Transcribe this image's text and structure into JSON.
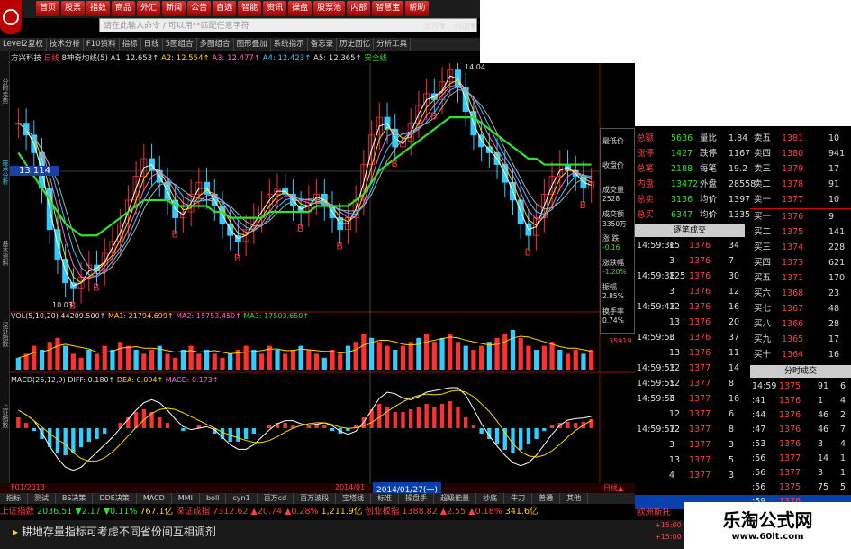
{
  "menu": {
    "items": [
      "首页",
      "股票",
      "指数",
      "商品",
      "外汇",
      "新闻",
      "公告",
      "自选",
      "智能",
      "资讯",
      "操盘",
      "股票池",
      "内部",
      "智慧宝",
      "帮助"
    ]
  },
  "search": {
    "placeholder": "请在此输入命令 / 可以用**匹配任意字符",
    "file_label": "文件▼",
    "layout_label": "画面▼"
  },
  "toolbar": {
    "items": [
      "Level2复权",
      "技术分析",
      "F10资料",
      "指标",
      "日线",
      "5图组合",
      "多图组合",
      "图形叠加",
      "系统指示",
      "备忘录",
      "历史回忆",
      "分析工具"
    ]
  },
  "chart_header": {
    "stock": "方兴科技",
    "period": "日线",
    "indicator": "8神奇均线(5)",
    "ma": [
      "A1: 12.653↑",
      "A2: 12.554↑",
      "A3: 12.477↑",
      "A4: 12.423↑",
      "A5: 12.365↑"
    ],
    "flag": "安全线"
  },
  "price_labels": {
    "cursor_price": "13.114",
    "low": "10.03",
    "high": "14.04"
  },
  "vol_header": {
    "name": "VOL(5,10,20)",
    "value": "44209.500↑",
    "ma1": "MA1: 21794.699↑",
    "ma2": "MA2: 15753.450↑",
    "ma3": "MA3: 17503.650↑",
    "right": "35919"
  },
  "macd_header": {
    "name": "MACD(26,12,9)",
    "diff": "DIFF: 0.180↑",
    "dea": "DEA: 0.094↑",
    "macd": "MACD: 0.173↑"
  },
  "date_labels": {
    "left": "F01/2013",
    "mid": "2014/01",
    "cursor_date": "2014/01/27(一)",
    "period": "日线▲"
  },
  "stats_panel": [
    {
      "label": "最低价",
      "value": ""
    },
    {
      "label": "收盘价",
      "value": ""
    },
    {
      "label": "成交量",
      "value": "2528"
    },
    {
      "label": "成交额",
      "value": "3350万"
    },
    {
      "label": "涨 跌",
      "value": "-0.16"
    },
    {
      "label": "涨跌幅",
      "value": "-1.20%"
    },
    {
      "label": "振幅",
      "value": "2.85%"
    },
    {
      "label": "换手率",
      "value": "0.74%"
    }
  ],
  "quote_top": [
    {
      "k1": "总额",
      "v1": "5636",
      "k2": "量比",
      "v2": "1.84"
    },
    {
      "k1": "涨停",
      "v1": "1427",
      "k2": "跌停",
      "v2": "1167"
    },
    {
      "k1": "总笔",
      "v1": "2188",
      "k2": "每笔",
      "v2": "19.2"
    },
    {
      "k1": "内盘",
      "v1": "13472",
      "k2": "外盘",
      "v2": "28558"
    },
    {
      "k1": "总卖",
      "v1": "3136",
      "k2": "均价",
      "v2": "1397"
    },
    {
      "k1": "总买",
      "v1": "6347",
      "k2": "均价",
      "v2": "1335"
    }
  ],
  "sell_orders": [
    {
      "name": "卖五",
      "price": "1381",
      "vol": "10"
    },
    {
      "name": "卖四",
      "price": "1380",
      "vol": "941"
    },
    {
      "name": "卖三",
      "price": "1379",
      "vol": "17"
    },
    {
      "name": "卖二",
      "price": "1378",
      "vol": "91"
    },
    {
      "name": "卖一",
      "price": "1377",
      "vol": "10"
    }
  ],
  "buy_orders": [
    {
      "name": "买一",
      "price": "1376",
      "vol": "9"
    },
    {
      "name": "买二",
      "price": "1375",
      "vol": "141"
    },
    {
      "name": "买三",
      "price": "1374",
      "vol": "228"
    },
    {
      "name": "买四",
      "price": "1373",
      "vol": "621"
    },
    {
      "name": "买五",
      "price": "1371",
      "vol": "170"
    },
    {
      "name": "买六",
      "price": "1368",
      "vol": "23"
    },
    {
      "name": "买七",
      "price": "1367",
      "vol": "48"
    },
    {
      "name": "买八",
      "price": "1366",
      "vol": "28"
    },
    {
      "name": "买九",
      "price": "1365",
      "vol": "17"
    },
    {
      "name": "买十",
      "price": "1364",
      "vol": "16"
    }
  ],
  "tick_header": "逐笔成交",
  "ticks": [
    {
      "t": "14:59:36",
      "a": "15",
      "p": "1376",
      "v": "34"
    },
    {
      "t": "",
      "a": "3",
      "p": "1376",
      "v": "7"
    },
    {
      "t": "14:59:38",
      "a": "125",
      "p": "1376",
      "v": "30"
    },
    {
      "t": "",
      "a": "3",
      "p": "1376",
      "v": "12"
    },
    {
      "t": "14:59:43",
      "a": "12",
      "p": "1376",
      "v": "16"
    },
    {
      "t": "",
      "a": "13",
      "p": "1376",
      "v": "20"
    },
    {
      "t": "14:59:50",
      "a": "3",
      "p": "1376",
      "v": "37"
    },
    {
      "t": "",
      "a": "13",
      "p": "1376",
      "v": "11"
    },
    {
      "t": "14:59:53",
      "a": "12",
      "p": "1377",
      "v": "14"
    },
    {
      "t": "14:59:55",
      "a": "12",
      "p": "1377",
      "v": "8"
    },
    {
      "t": "14:59:56",
      "a": "3",
      "p": "1377",
      "v": "16"
    },
    {
      "t": "",
      "a": "12",
      "p": "1377",
      "v": "6"
    },
    {
      "t": "14:59:57",
      "a": "12",
      "p": "1377",
      "v": "8"
    },
    {
      "t": "",
      "a": "3",
      "p": "1377",
      "v": "3"
    },
    {
      "t": "",
      "a": "13",
      "p": "1377",
      "v": "5"
    },
    {
      "t": "",
      "a": "4",
      "p": "1377",
      "v": "3"
    }
  ],
  "minute_header": "分时成交",
  "minute_ticks": [
    {
      "t": "14:59",
      "p": "1375",
      "v": "91",
      "a": "6"
    },
    {
      "t": ":41",
      "p": "1376",
      "v": "1",
      "a": "4"
    },
    {
      "t": ":44",
      "p": "1376",
      "v": "46",
      "a": "2"
    },
    {
      "t": ":47",
      "p": "1376",
      "v": "46",
      "a": "7"
    },
    {
      "t": ":53",
      "p": "1376",
      "v": "3",
      "a": "4"
    },
    {
      "t": ":56",
      "p": "1377",
      "v": "14",
      "a": "1"
    },
    {
      "t": ":56",
      "p": "1377",
      "v": "3",
      "a": "1"
    },
    {
      "t": ":56",
      "p": "1375",
      "v": "75",
      "a": "5"
    },
    {
      "t": ":59",
      "p": "1376",
      "v": "",
      "a": ""
    }
  ],
  "bottom_tabs": [
    "指标",
    "测试",
    "BS决策",
    "DDE决策",
    "MACD",
    "MMI",
    "boll",
    "cyn1",
    "百万cd",
    "百万波段",
    "宝塔线",
    "标准",
    "操盘手",
    "超级能量",
    "抄底",
    "牛刀",
    "普通",
    "其他"
  ],
  "index_bar": {
    "sh_name": "上证指数",
    "sh_val": "2036.51",
    "sh_chg": "▼2.17",
    "sh_pct": "▼0.11%",
    "sh_amt": "767.1亿",
    "sz_name": "深证成指",
    "sz_val": "7312.62",
    "sz_chg": "▲20.74",
    "sz_pct": "▲0.28%",
    "sz_amt": "1,211.9亿",
    "cy_name": "创业板指",
    "cy_val": "1388.82",
    "cy_chg": "▲2.55",
    "cy_pct": "▲0.18%",
    "cy_amt": "341.6亿",
    "extra": "欧洲斯托"
  },
  "scroll_text": "耕地存量指标可考虑不同省份间互相调剂",
  "clock": {
    "t1": "+15:00",
    "t2": "+15:00"
  },
  "brand": {
    "title": "乐淘公式网",
    "url": "www.60lt.com"
  },
  "left_vertical": [
    "分时走势",
    "技术分析",
    "基本资料",
    "深证指数",
    "上证指数"
  ],
  "marker": "B",
  "chart_data": [
    {
      "type": "candlestick",
      "title": "",
      "ylim": [
        10.03,
        14.04
      ],
      "closes": [
        13.1,
        12.9,
        12.6,
        12.0,
        11.3,
        10.8,
        10.4,
        10.3,
        10.5,
        10.7,
        10.6,
        10.9,
        11.1,
        11.4,
        11.8,
        12.2,
        12.5,
        12.3,
        12.1,
        11.8,
        11.5,
        11.6,
        11.9,
        12.1,
        11.9,
        11.7,
        11.4,
        11.2,
        11.1,
        11.3,
        11.5,
        11.7,
        11.9,
        12.0,
        11.9,
        11.7,
        11.6,
        11.8,
        11.9,
        11.7,
        11.5,
        11.3,
        11.5,
        11.8,
        12.4,
        12.9,
        13.2,
        13.0,
        12.7,
        12.8,
        13.1,
        13.4,
        13.6,
        13.5,
        13.8,
        14.0,
        13.7,
        13.3,
        12.9,
        12.7,
        12.6,
        12.4,
        12.1,
        11.8,
        11.4,
        11.2,
        11.5,
        11.9,
        12.2,
        12.4,
        12.3,
        12.2,
        12.0,
        12.1
      ],
      "series": [
        {
          "name": "A1",
          "values": []
        },
        {
          "name": "安全线",
          "values": [
            12.6,
            12.4,
            12.2,
            12.0,
            11.8,
            11.6,
            11.4,
            11.3,
            11.2,
            11.2,
            11.2,
            11.3,
            11.4,
            11.5,
            11.6,
            11.7,
            11.8,
            11.8,
            11.8,
            11.8,
            11.7,
            11.7,
            11.7,
            11.7,
            11.7,
            11.6,
            11.6,
            11.5,
            11.5,
            11.5,
            11.5,
            11.5,
            11.6,
            11.6,
            11.6,
            11.6,
            11.6,
            11.6,
            11.7,
            11.7,
            11.7,
            11.7,
            11.7,
            11.8,
            11.9,
            12.1,
            12.3,
            12.4,
            12.5,
            12.6,
            12.7,
            12.8,
            12.9,
            13.0,
            13.1,
            13.2,
            13.2,
            13.2,
            13.2,
            13.1,
            13.0,
            12.9,
            12.8,
            12.7,
            12.6,
            12.5,
            12.5,
            12.4,
            12.4,
            12.4,
            12.4,
            12.4,
            12.4,
            12.4
          ]
        }
      ]
    },
    {
      "type": "bar",
      "title": "",
      "values": [
        3,
        4,
        6,
        5,
        7,
        8,
        6,
        4,
        3,
        5,
        4,
        6,
        5,
        7,
        6,
        5,
        4,
        5,
        6,
        4,
        3,
        5,
        6,
        4,
        5,
        4,
        3,
        4,
        5,
        6,
        5,
        4,
        6,
        5,
        4,
        5,
        6,
        5,
        4,
        3,
        5,
        4,
        6,
        7,
        9,
        8,
        7,
        6,
        5,
        6,
        7,
        8,
        9,
        7,
        8,
        9,
        7,
        6,
        5,
        6,
        7,
        8,
        9,
        10,
        8,
        6,
        5,
        6,
        7,
        5,
        4,
        5,
        4,
        5
      ]
    },
    {
      "type": "bar",
      "title": "",
      "values": [
        0.2,
        0.1,
        -0.05,
        -0.2,
        -0.35,
        -0.45,
        -0.5,
        -0.45,
        -0.35,
        -0.25,
        -0.2,
        -0.1,
        0.0,
        0.1,
        0.2,
        0.3,
        0.35,
        0.3,
        0.2,
        0.1,
        0.0,
        -0.05,
        0.0,
        0.05,
        0.0,
        -0.1,
        -0.2,
        -0.25,
        -0.25,
        -0.2,
        -0.1,
        0.0,
        0.05,
        0.1,
        0.1,
        0.05,
        0.0,
        0.05,
        0.08,
        0.05,
        -0.05,
        -0.1,
        -0.05,
        0.05,
        0.2,
        0.35,
        0.45,
        0.4,
        0.3,
        0.3,
        0.35,
        0.4,
        0.45,
        0.4,
        0.45,
        0.5,
        0.4,
        0.2,
        0.05,
        -0.1,
        -0.2,
        -0.3,
        -0.4,
        -0.45,
        -0.4,
        -0.3,
        -0.2,
        -0.05,
        0.05,
        0.1,
        0.12,
        0.1,
        0.12,
        0.17
      ]
    }
  ]
}
